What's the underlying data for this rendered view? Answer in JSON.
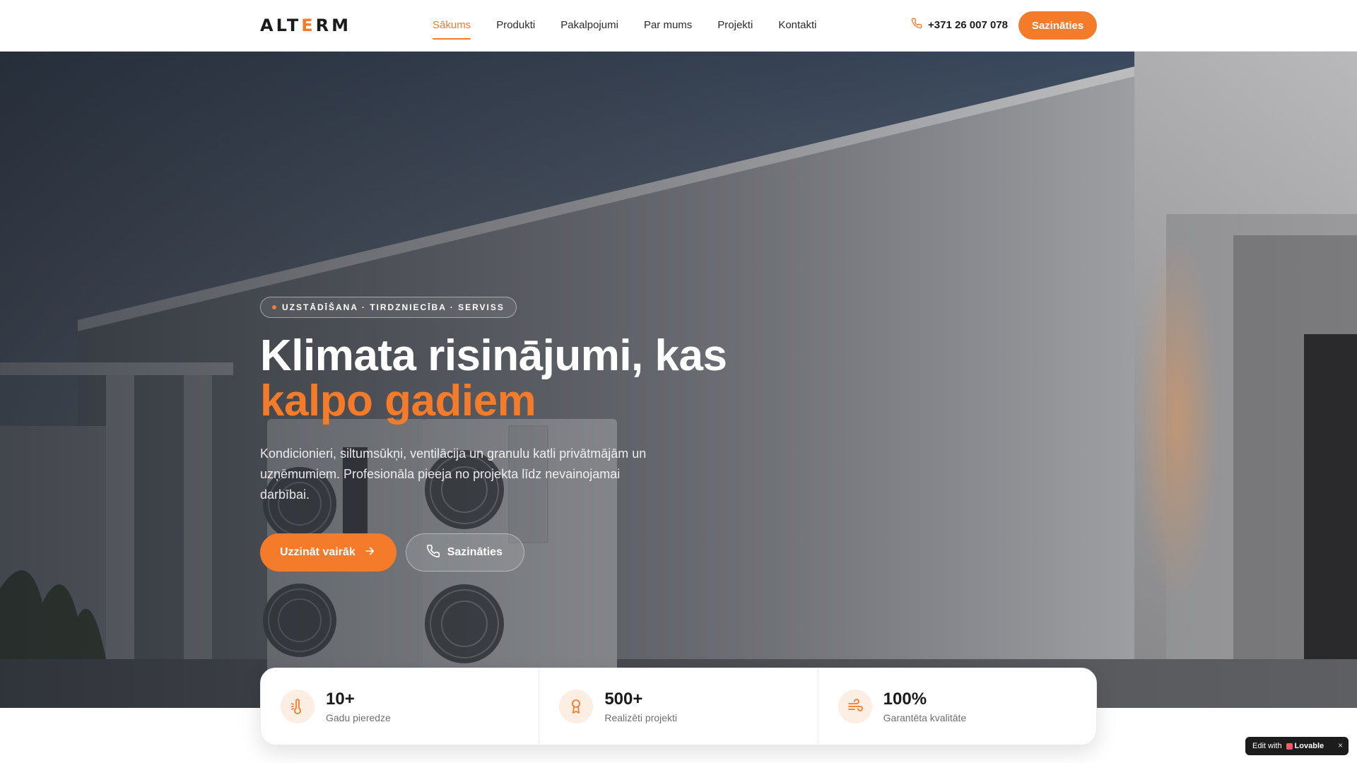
{
  "header": {
    "logo_prefix": "ALT",
    "logo_accent": "E",
    "logo_suffix": "RM",
    "nav": [
      {
        "label": "Sākums",
        "active": true
      },
      {
        "label": "Produkti"
      },
      {
        "label": "Pakalpojumi"
      },
      {
        "label": "Par mums"
      },
      {
        "label": "Projekti"
      },
      {
        "label": "Kontakti"
      }
    ],
    "phone": "+371 26 007 078",
    "cta": "Sazināties"
  },
  "hero": {
    "badge": "UZSTĀDĪŠANA · TIRDZNIECĪBA · SERVISS",
    "headline_line1": "Klimata risinājumi, kas",
    "headline_line2": "kalpo gadiem",
    "lead": "Kondicionieri, siltumsūkņi, ventilācija un granulu katli privātmājām un uzņēmumiem. Profesionāla pieeja no projekta līdz nevainojamai darbībai.",
    "primary_button": "Uzzināt vairāk",
    "secondary_button": "Sazināties"
  },
  "stats": [
    {
      "icon": "thermometer-icon",
      "value": "10+",
      "label": "Gadu pieredze"
    },
    {
      "icon": "award-icon",
      "value": "500+",
      "label": "Realizēti projekti"
    },
    {
      "icon": "wind-icon",
      "value": "100%",
      "label": "Garantēta kvalitāte"
    }
  ],
  "lovable_badge": {
    "prefix": "Edit with",
    "brand": "Lovable",
    "close": "×"
  },
  "colors": {
    "accent": "#f47b2a",
    "accent_soft": "#fdeee3",
    "text_dark": "#1b1b1b"
  }
}
